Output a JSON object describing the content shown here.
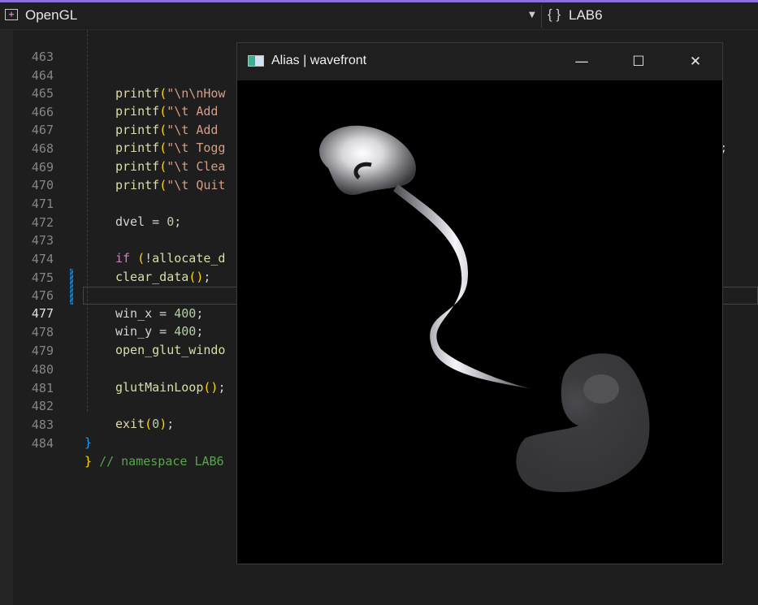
{
  "navbar": {
    "project_icon": "project-glyph",
    "project_name": "OpenGL",
    "dropdown_glyph": "▼",
    "scope_icon": "{ }",
    "scope_name": "LAB6"
  },
  "code_lines": [
    {
      "n": "463"
    },
    {
      "n": "464",
      "t": "printf(\"\\n\\nHow"
    },
    {
      "n": "465",
      "t": "printf(\"\\t Add"
    },
    {
      "n": "466",
      "t": "printf(\"\\t Add",
      "tail": "n\");"
    },
    {
      "n": "467",
      "t": "printf(\"\\t Togg"
    },
    {
      "n": "468",
      "t": "printf(\"\\t Clea"
    },
    {
      "n": "469",
      "t": "printf(\"\\t Quit"
    },
    {
      "n": "470"
    },
    {
      "n": "471",
      "t": "dvel = 0;"
    },
    {
      "n": "472"
    },
    {
      "n": "473",
      "t": "if (!allocate_d"
    },
    {
      "n": "474",
      "t": "clear_data();"
    },
    {
      "n": "475"
    },
    {
      "n": "476",
      "t": "win_x = 400;"
    },
    {
      "n": "477",
      "t": "win_y = 400;"
    },
    {
      "n": "478",
      "t": "open_glut_windo"
    },
    {
      "n": "479"
    },
    {
      "n": "480",
      "t": "glutMainLoop();"
    },
    {
      "n": "481"
    },
    {
      "n": "482",
      "t": "exit(0);"
    },
    {
      "n": "483",
      "t": "}"
    },
    {
      "n": "484",
      "t": "} // namespace LAB6"
    }
  ],
  "glut_window": {
    "title": "Alias | wavefront",
    "icon": "app-window-icon",
    "minimize": "—",
    "maximize": "☐",
    "close": "✕"
  },
  "colors": {
    "accent": "#8a6fd8",
    "editor_bg": "#1e1e1e",
    "function": "#dcdcaa",
    "string": "#d69d85",
    "number": "#b5cea8",
    "keyword": "#c586c0",
    "comment": "#57a64a"
  }
}
